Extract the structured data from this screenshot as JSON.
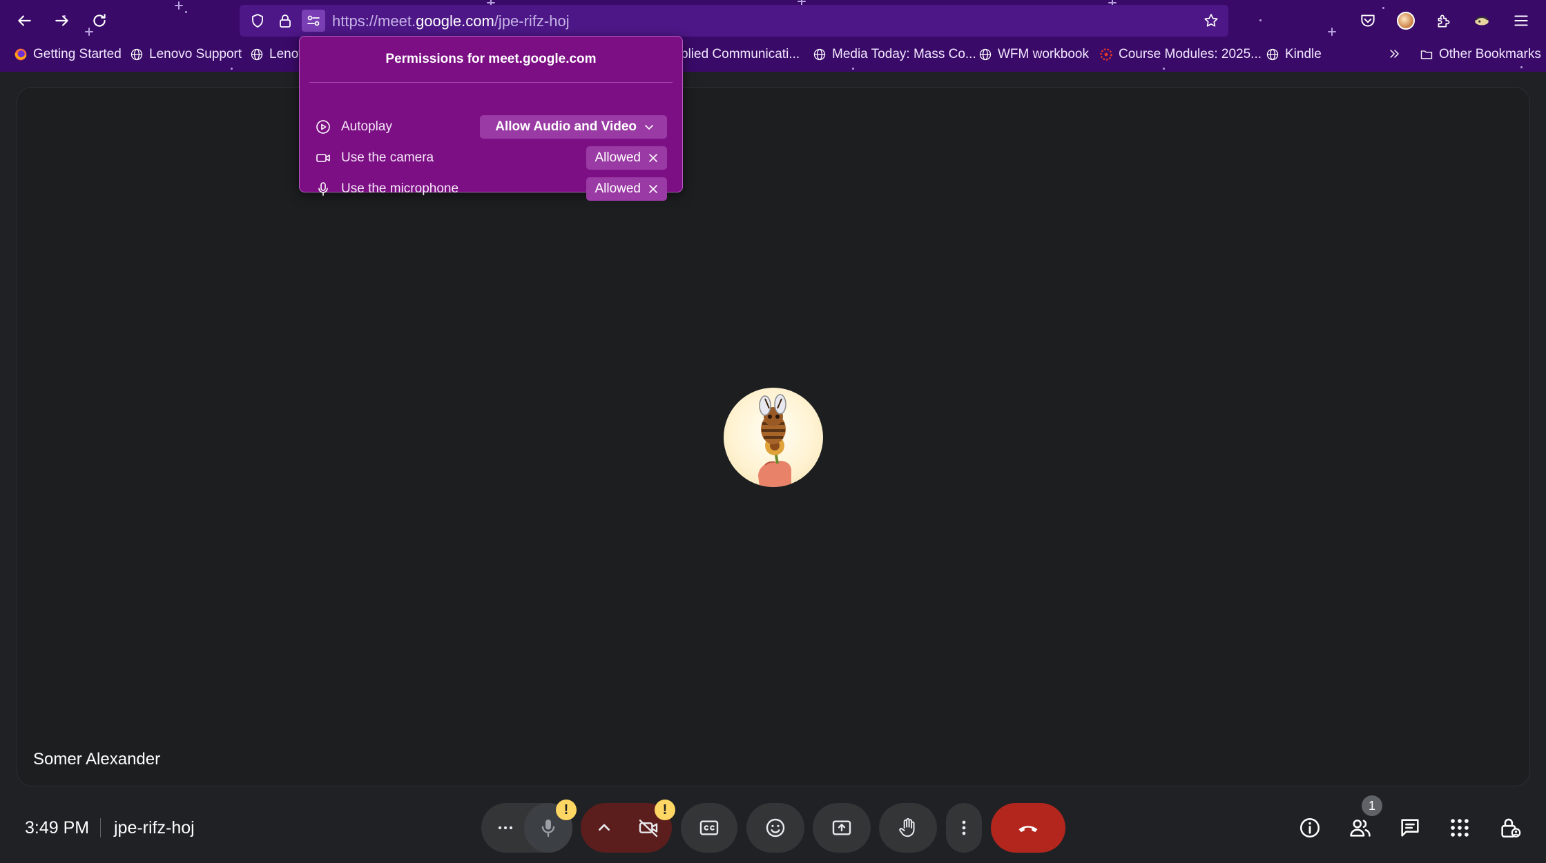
{
  "browser": {
    "url_prefix": "https://meet.",
    "url_domain": "google.com",
    "url_path": "/jpe-rifz-hoj",
    "bookmarks": [
      "Getting Started",
      "Lenovo Support",
      "Lenov",
      "plied Communicati...",
      "Media Today: Mass Co...",
      "WFM workbook",
      "Course Modules: 2025...",
      "Kindle"
    ],
    "other_bookmarks": "Other Bookmarks"
  },
  "permissions": {
    "title": "Permissions for meet.google.com",
    "rows": [
      {
        "label": "Autoplay",
        "value": "Allow Audio and Video"
      },
      {
        "label": "Use the camera",
        "value": "Allowed"
      },
      {
        "label": "Use the microphone",
        "value": "Allowed"
      }
    ]
  },
  "meeting": {
    "participant_name": "Somer Alexander",
    "time": "3:49 PM",
    "code": "jpe-rifz-hoj",
    "people_count": "1",
    "mic_warning": "!",
    "cam_warning": "!"
  },
  "colors": {
    "browser_accent": "#3a0a68",
    "popup_bg": "#7d0f85",
    "hangup": "#b3261e",
    "warning": "#fdd663"
  }
}
